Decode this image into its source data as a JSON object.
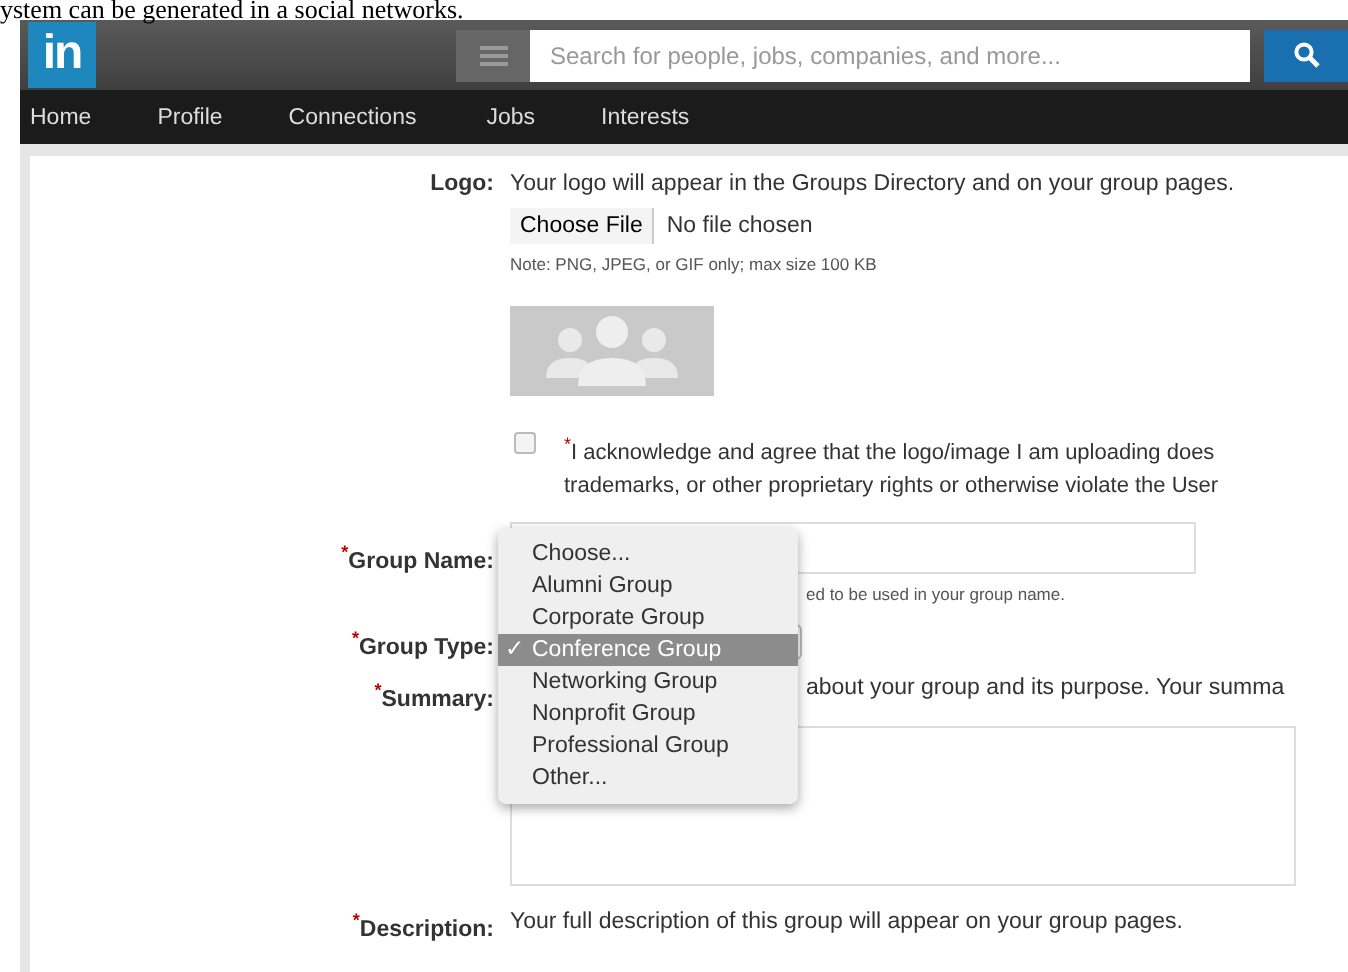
{
  "caption": "ystem can be generated in a social networks.",
  "header": {
    "logo": "in",
    "search": {
      "placeholder": "Search for people, jobs, companies, and more..."
    }
  },
  "nav": [
    {
      "label": "Home"
    },
    {
      "label": "Profile"
    },
    {
      "label": "Connections"
    },
    {
      "label": "Jobs"
    },
    {
      "label": "Interests"
    }
  ],
  "form": {
    "logo": {
      "label": "Logo:",
      "text": "Your logo will appear in the Groups Directory and on your group pages.",
      "file_button": "Choose File",
      "file_status": "No file chosen",
      "note": "Note: PNG, JPEG, or GIF only; max size 100 KB"
    },
    "acknowledge": {
      "checked": false,
      "lines": [
        "$^{*}$I acknowledge and agree that the logo/image I am uploading does",
        "trademarks, or other proprietary rights or otherwise violate the User"
      ]
    },
    "group_name": {
      "label": "$^{*}$Group Name:",
      "hint": "ed to be used in your group name."
    },
    "group_type": {
      "label": "$^{*}$Group Type:",
      "options": [
        {
          "label": "Choose...",
          "selected": false
        },
        {
          "label": "Alumni Group",
          "selected": false
        },
        {
          "label": "Corporate Group",
          "selected": false
        },
        {
          "label": "Conference Group",
          "selected": true,
          "check": "✓"
        },
        {
          "label": "Networking Group",
          "selected": false
        },
        {
          "label": "Nonprofit Group",
          "selected": false
        },
        {
          "label": "Professional Group",
          "selected": false
        },
        {
          "label": "Other...",
          "selected": false
        }
      ]
    },
    "summary": {
      "label": "$^{*}$Summary:",
      "text": "about your group and its purpose. Your summa"
    },
    "description": {
      "label": "$^{*}$Description:",
      "text": "Your full description of this group will appear on your group pages."
    }
  }
}
